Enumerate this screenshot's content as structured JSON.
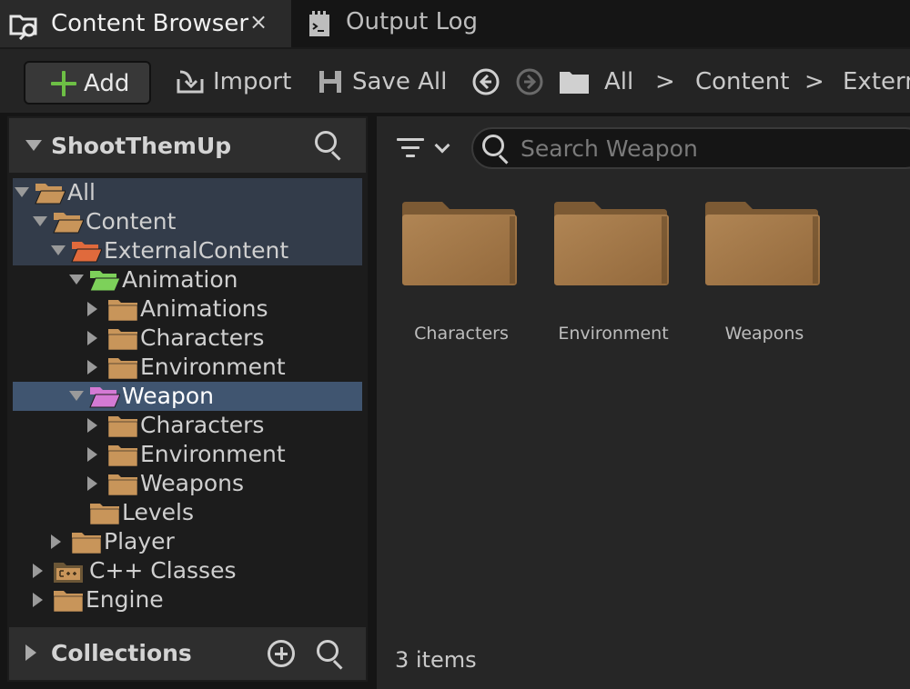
{
  "tabs": [
    {
      "label": "Content Browser",
      "active": true,
      "icon": "content-browser-icon"
    },
    {
      "label": "Output Log",
      "active": false,
      "icon": "output-log-icon"
    }
  ],
  "tab_close_glyph": "×",
  "toolbar": {
    "add_label": "Add",
    "import_label": "Import",
    "save_all_label": "Save All",
    "breadcrumbs": [
      "All",
      "Content",
      "Extern"
    ],
    "chevron": ">"
  },
  "sources": {
    "title": "ShootThemUp",
    "tree": [
      {
        "label": "All",
        "expand": "down",
        "color": "#c8955a"
      },
      {
        "label": "Content",
        "expand": "down",
        "color": "#c8955a"
      },
      {
        "label": "ExternalContent",
        "expand": "down",
        "color": "#e06a3c"
      },
      {
        "label": "Animation",
        "expand": "down",
        "color": "#7dd15a"
      },
      {
        "label": "Animations",
        "expand": "right",
        "color": "#c8955a"
      },
      {
        "label": "Characters",
        "expand": "right",
        "color": "#c8955a"
      },
      {
        "label": "Environment",
        "expand": "right",
        "color": "#c8955a"
      },
      {
        "label": "Weapon",
        "expand": "down",
        "color": "#d47ad4"
      },
      {
        "label": "Characters",
        "expand": "right",
        "color": "#c8955a"
      },
      {
        "label": "Environment",
        "expand": "right",
        "color": "#c8955a"
      },
      {
        "label": "Weapons",
        "expand": "right",
        "color": "#c8955a"
      },
      {
        "label": "Levels",
        "expand": "none",
        "color": "#c8955a"
      },
      {
        "label": "Player",
        "expand": "right",
        "color": "#c8955a"
      },
      {
        "label": "C++ Classes",
        "expand": "right",
        "color": "#c8955a"
      },
      {
        "label": "Engine",
        "expand": "right",
        "color": "#c8955a"
      }
    ],
    "collections_title": "Collections"
  },
  "content": {
    "search_placeholder": "Search Weapon",
    "folders": [
      "Characters",
      "Environment",
      "Weapons"
    ],
    "folder_color": "#a97c4c",
    "items_count": "3 items"
  },
  "colors": {
    "accent_green": "#6dbf45",
    "selection": "#405570",
    "highlight": "#333c4a"
  }
}
